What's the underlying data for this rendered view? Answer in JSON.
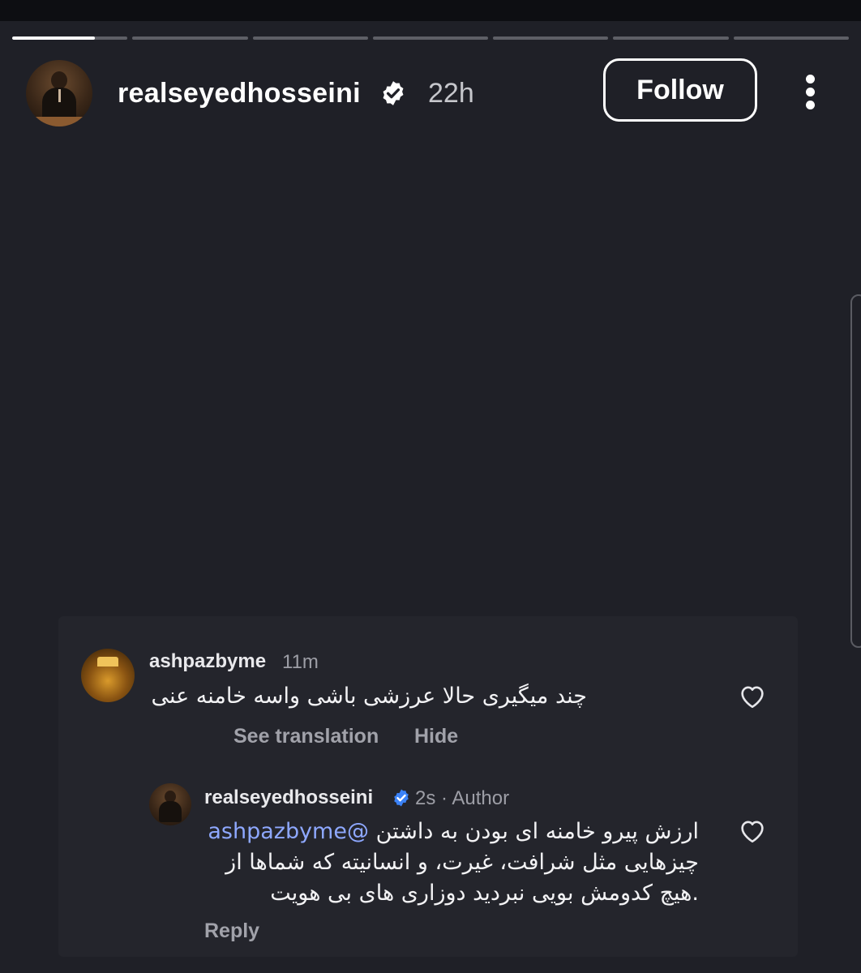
{
  "story": {
    "progress_segments": 7,
    "active_segment_fill": 0.72
  },
  "header": {
    "username": "realseyedhosseini",
    "verified": true,
    "time_ago": "22h",
    "follow_label": "Follow"
  },
  "comments": [
    {
      "username": "ashpazbyme",
      "time": "11m",
      "text": "چند میگیری حالا عرزشی باشی واسه خامنه عنی",
      "see_translation": "See translation",
      "hide": "Hide"
    },
    {
      "username": "realseyedhosseini",
      "verified": true,
      "time_meta": "2s · Author",
      "mention": "@ashpazbyme",
      "text_line1": "ارزش پیرو خامنه ای بودن به داشتن",
      "text_line2": "چیزهایی مثل شرافت، غیرت، و انسانیته که شماها از",
      "text_line3": ".هیچ کدومش بویی نبردید دوزاری های بی هویت",
      "reply": "Reply"
    }
  ],
  "colors": {
    "background": "#1f2027",
    "panel": "#24252c",
    "mention": "#8ea8ff",
    "verified_blue": "#3b82f6"
  }
}
